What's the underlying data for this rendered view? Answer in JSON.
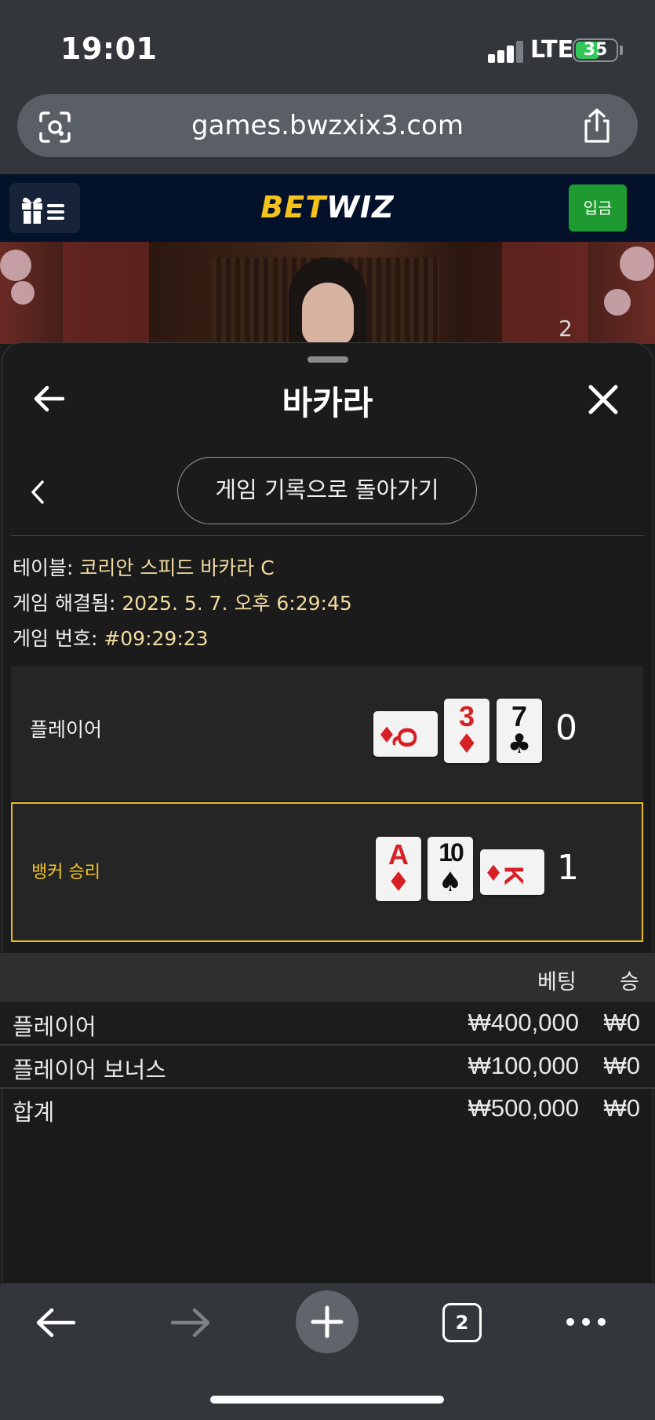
{
  "status": {
    "time": "19:01",
    "network": "LTE",
    "battery": "35"
  },
  "browser": {
    "url": "games.bwzxix3.com",
    "tab_count": "2"
  },
  "site": {
    "logo_bet": "BET",
    "logo_wiz": "WIZ",
    "deposit_label": "입금",
    "video_count": "2"
  },
  "sheet": {
    "title": "바카라",
    "back_to_history": "게임 기록으로 돌아가기",
    "table_label": "테이블: ",
    "table_value": "코리안 스피드 바카라 C",
    "resolved_label": "게임 해결됨: ",
    "resolved_value": "2025. 5. 7. 오후 6:29:45",
    "game_no_label": "게임 번호: ",
    "game_no_value": "#09:29:23"
  },
  "result": {
    "player": {
      "label": "플레이어",
      "score": "0",
      "cards": [
        {
          "rank": "Q",
          "suit": "♦",
          "color": "red",
          "rotated": true
        },
        {
          "rank": "3",
          "suit": "♦",
          "color": "red",
          "rotated": false
        },
        {
          "rank": "7",
          "suit": "♣",
          "color": "black",
          "rotated": false
        }
      ]
    },
    "banker": {
      "label": "뱅커 승리",
      "score": "1",
      "cards": [
        {
          "rank": "A",
          "suit": "♦",
          "color": "red",
          "rotated": false
        },
        {
          "rank": "10",
          "suit": "♠",
          "color": "black",
          "rotated": false
        },
        {
          "rank": "K",
          "suit": "♦",
          "color": "red",
          "rotated": true
        }
      ]
    }
  },
  "bets": {
    "headers": {
      "bet": "베팅",
      "win": "승"
    },
    "rows": [
      {
        "name": "플레이어",
        "bet": "₩400,000",
        "win": "₩0"
      },
      {
        "name": "플레이어 보너스",
        "bet": "₩100,000",
        "win": "₩0"
      },
      {
        "name": "합계",
        "bet": "₩500,000",
        "win": "₩0"
      }
    ]
  },
  "icons": {
    "lens": "camera-lens-icon",
    "share": "share-icon",
    "menu": "gift-menu-icon",
    "back": "arrow-left-icon",
    "close": "close-icon",
    "prev": "chevron-left-icon",
    "toolbar": [
      "arrow-left-icon",
      "arrow-right-icon",
      "plus-icon",
      "tabs-icon",
      "more-icon"
    ]
  },
  "colors": {
    "accent_gold": "#f4c21a",
    "banker_border": "#e6b824",
    "deposit_green": "#1e9a31",
    "card_red": "#d71f26"
  }
}
